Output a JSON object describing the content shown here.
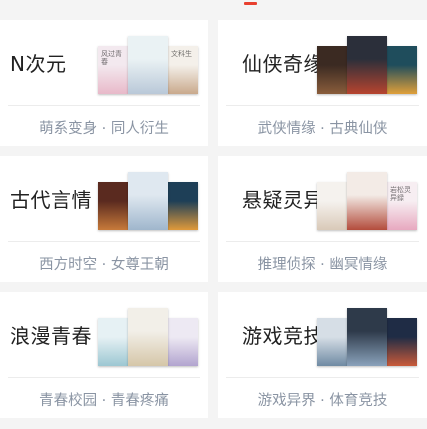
{
  "tab_indicator_color": "#e8402f",
  "categories": [
    {
      "name": "N次元",
      "tags": "萌系变身 · 同人衍生",
      "covers": [
        {
          "bg": "#f3e9ef",
          "art": "#e8b9c9",
          "title": "风过青春"
        },
        {
          "bg": "#f4f0ea",
          "art": "#c9a98c",
          "title": "文科生"
        },
        {
          "bg": "#eaf2f4",
          "art": "#b9c8d8",
          "title": ""
        }
      ]
    },
    {
      "name": "仙侠奇缘",
      "tags": "武侠情缘 · 古典仙侠",
      "covers": [
        {
          "bg": "#3b2a22",
          "art": "#8a5d3b",
          "title": ""
        },
        {
          "bg": "#1f4d5c",
          "art": "#e0a03a",
          "title": ""
        },
        {
          "bg": "#2b2f3a",
          "art": "#b7442f",
          "title": ""
        }
      ]
    },
    {
      "name": "古代言情",
      "tags": "西方时空 · 女尊王朝",
      "covers": [
        {
          "bg": "#5a2a1f",
          "art": "#c77a3a",
          "title": ""
        },
        {
          "bg": "#1e3f57",
          "art": "#e09a3b",
          "title": ""
        },
        {
          "bg": "#dfe8f0",
          "art": "#9fb6cc",
          "title": ""
        }
      ]
    },
    {
      "name": "悬疑灵异",
      "tags": "推理侦探 · 幽冥情缘",
      "covers": [
        {
          "bg": "#f5f2ee",
          "art": "#d9c9b8",
          "title": ""
        },
        {
          "bg": "#f7eef2",
          "art": "#e7a8bf",
          "title": "岩松灵异録"
        },
        {
          "bg": "#f3ebe6",
          "art": "#b34c3c",
          "title": ""
        }
      ]
    },
    {
      "name": "浪漫青春",
      "tags": "青春校园 · 青春疼痛",
      "covers": [
        {
          "bg": "#e6f1f4",
          "art": "#9cc7d2",
          "title": ""
        },
        {
          "bg": "#ede9f3",
          "art": "#b2a4cf",
          "title": ""
        },
        {
          "bg": "#f2efe8",
          "art": "#d5c6a8",
          "title": ""
        }
      ]
    },
    {
      "name": "游戏竞技",
      "tags": "游戏异界 · 体育竞技",
      "covers": [
        {
          "bg": "#d6dee6",
          "art": "#6f8aa3",
          "title": ""
        },
        {
          "bg": "#1f2c45",
          "art": "#c95a3a",
          "title": ""
        },
        {
          "bg": "#2e3a4a",
          "art": "#8aa2bb",
          "title": ""
        }
      ]
    }
  ]
}
